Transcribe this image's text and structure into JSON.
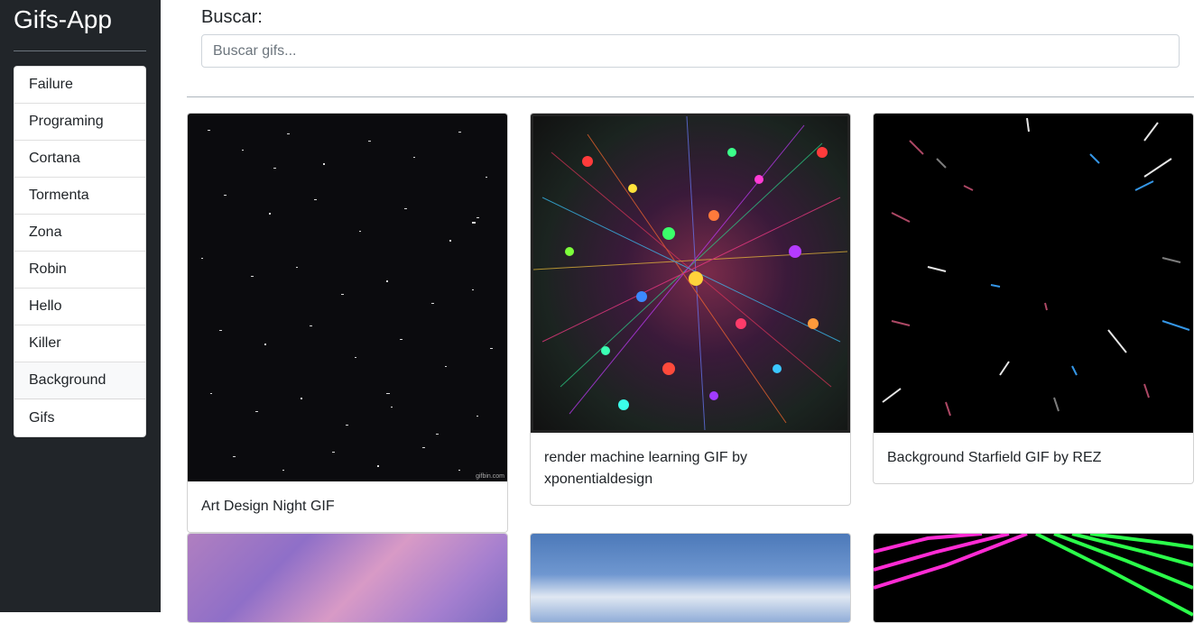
{
  "app": {
    "title": "Gifs-App"
  },
  "sidebar": {
    "items": [
      {
        "label": "Failure"
      },
      {
        "label": "Programing"
      },
      {
        "label": "Cortana"
      },
      {
        "label": "Tormenta"
      },
      {
        "label": "Zona"
      },
      {
        "label": "Robin"
      },
      {
        "label": "Hello"
      },
      {
        "label": "Killer"
      },
      {
        "label": "Background"
      },
      {
        "label": "Gifs"
      }
    ],
    "active_item": "Background"
  },
  "search": {
    "label": "Buscar:",
    "value": "",
    "placeholder": "Buscar gifs..."
  },
  "results": [
    {
      "title": "Art Design Night GIF",
      "watermark": "gifbin.com"
    },
    {
      "title": "render machine learning GIF by xponentialdesign"
    },
    {
      "title": "Background Starfield GIF by REZ"
    },
    {
      "title": ""
    },
    {
      "title": ""
    },
    {
      "title": ""
    }
  ],
  "colors": {
    "sidebar_bg": "#212529",
    "page_bg": "#ffffff",
    "text": "#212529",
    "active_item_bg": "#f8f9fa"
  }
}
